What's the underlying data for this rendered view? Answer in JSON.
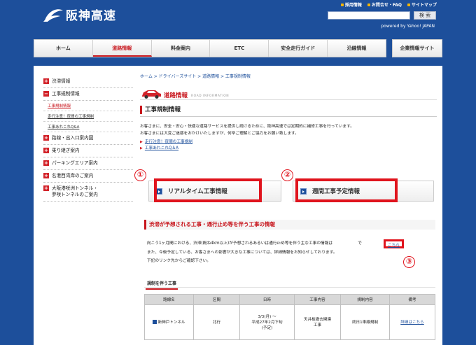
{
  "header": {
    "logo_text": "阪神高速",
    "links": [
      "採用情報",
      "お問合せ・FAQ",
      "サイトマップ"
    ],
    "search_button": "検 索",
    "powered": "powered by Yahoo! JAPAN"
  },
  "nav": {
    "items": [
      "ホーム",
      "道路情報",
      "料金案内",
      "ETC",
      "安全走行ガイド",
      "沿線情報"
    ],
    "corporate": "企業情報サイト"
  },
  "sidebar": {
    "items": [
      {
        "label": "渋滞情報"
      },
      {
        "label": "工事規制情報"
      },
      {
        "label": "路線・出入口案内図"
      },
      {
        "label": "乗り継ぎ案内"
      },
      {
        "label": "パーキングエリア案内"
      },
      {
        "label": "名港西湾岸のご案内"
      },
      {
        "label": "大阪港咲洲トンネル・\n夢咲トンネルのご案内"
      }
    ],
    "subitems": [
      "工事規制情報",
      "走行注意！夜間の工事規制",
      "工事あれこれQ&A"
    ]
  },
  "main": {
    "breadcrumb": "ホーム > ドライバーズサイト > 道路情報 > 工事規制情報",
    "section_title": "道路情報",
    "section_en": "ROAD INFORMATION",
    "page_title": "工事規制情報",
    "intro_1": "お客さまに、安全・安心・快適な道路サービスを提供し続けるために、阪神高速では定期的に補修工事を行っています。",
    "intro_2": "お客さまには大変ご迷惑をおかけいたしますが、何卒ご理解とご協力をお願い致します。",
    "intro_links": [
      "走行注意！夜間の工事規制",
      "工事あれこれQ＆A"
    ],
    "btn_realtime": "リアルタイム工事情報",
    "btn_weekly": "週間工事予定情報",
    "circle_1": "①",
    "circle_2": "②",
    "circle_3": "③",
    "subhead": "渋滞が予想される工事・通行止め等を伴う工事の情報",
    "notice_1": "向こう1ヶ月間における、渋滞(概ね4km以上)が予想されるあるいは通行止め等を伴う主な工事の情報は",
    "kochira": "こちら",
    "notice_1_end": "で",
    "notice_2": "また、今後予定している、お客さまへの影響が大きな工事については、詳細情報をお知らせしております。",
    "notice_3": "下記のリンク先からご確認下さい。",
    "tab_label": "規制を伴う工事"
  },
  "table": {
    "headers": [
      "路線名",
      "区間",
      "日時",
      "工事内容",
      "規制内容",
      "備考"
    ],
    "rows": [
      {
        "route": "新神戸トンネル",
        "section": "北行",
        "datetime_1": "3/3(月) ～",
        "datetime_2": "平成27年2月下旬",
        "datetime_3": "(予定)",
        "work_1": "天井板撤去関連",
        "work_2": "工事",
        "regulation": "終日1車線規制",
        "note": "詳細はこちら"
      }
    ]
  }
}
